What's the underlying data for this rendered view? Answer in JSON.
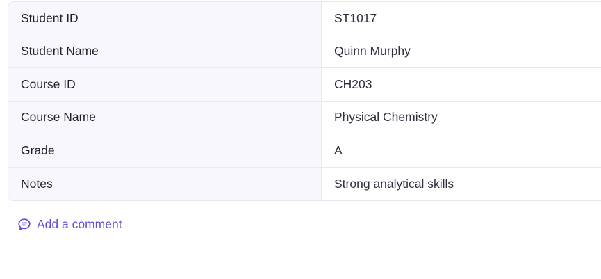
{
  "record": {
    "rows": [
      {
        "label": "Student ID",
        "value": "ST1017"
      },
      {
        "label": "Student Name",
        "value": "Quinn Murphy"
      },
      {
        "label": "Course ID",
        "value": "CH203"
      },
      {
        "label": "Course Name",
        "value": "Physical Chemistry"
      },
      {
        "label": "Grade",
        "value": "A"
      },
      {
        "label": "Notes",
        "value": "Strong analytical skills"
      }
    ]
  },
  "comment": {
    "label": "Add a comment",
    "icon": "comment-icon"
  },
  "colors": {
    "accent": "#5b4fd6",
    "label_bg": "#f8f7fd",
    "border": "#e8e8ef"
  }
}
